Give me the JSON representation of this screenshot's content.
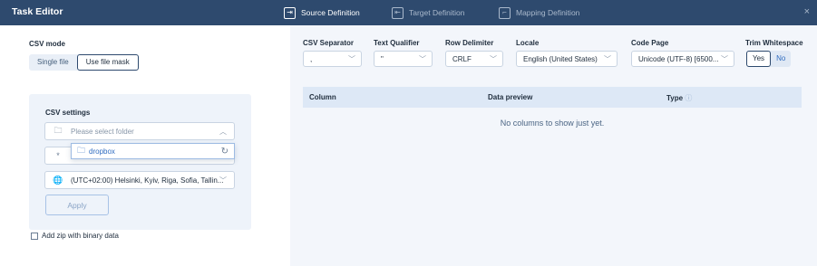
{
  "header": {
    "title": "Task Editor",
    "tabs": [
      {
        "label": "Source Definition",
        "icon": "source-icon",
        "active": true
      },
      {
        "label": "Target Definition",
        "icon": "target-icon",
        "active": false
      },
      {
        "label": "Mapping Definition",
        "icon": "mapping-icon",
        "active": false
      }
    ],
    "close_label": "×"
  },
  "left": {
    "csv_mode_label": "CSV mode",
    "modes": [
      "Single file",
      "Use file mask"
    ],
    "selected_mode": "Use file mask",
    "settings_label": "CSV settings",
    "folder_placeholder": "Please select folder",
    "mask_field_text": "*",
    "timezone_value": "(UTC+02:00) Helsinki, Kyiv, Riga, Sofia, Tallin...",
    "dropdown_item": "dropbox",
    "apply_label": "Apply",
    "zip_checkbox_label": "Add zip with binary data",
    "zip_checked": false
  },
  "right": {
    "fields": [
      {
        "label": "CSV Separator",
        "value": ","
      },
      {
        "label": "Text Qualifier",
        "value": "\""
      },
      {
        "label": "Row Delimiter",
        "value": "CRLF"
      },
      {
        "label": "Locale",
        "value": "English (United States)"
      },
      {
        "label": "Code Page",
        "value": "Unicode (UTF-8) [6500..."
      },
      {
        "label": "Trim Whitespace",
        "value": ""
      }
    ],
    "trim_options": [
      "Yes",
      "No"
    ],
    "trim_selected": "Yes",
    "table": {
      "columns": [
        "Column",
        "Data preview",
        "Type"
      ],
      "type_info_icon": "info-icon",
      "empty_text": "No columns to show just yet."
    }
  },
  "colors": {
    "header_bg": "#2e4a6e",
    "panel_bg": "#f3f6fb",
    "accent": "#2f6cc0"
  }
}
